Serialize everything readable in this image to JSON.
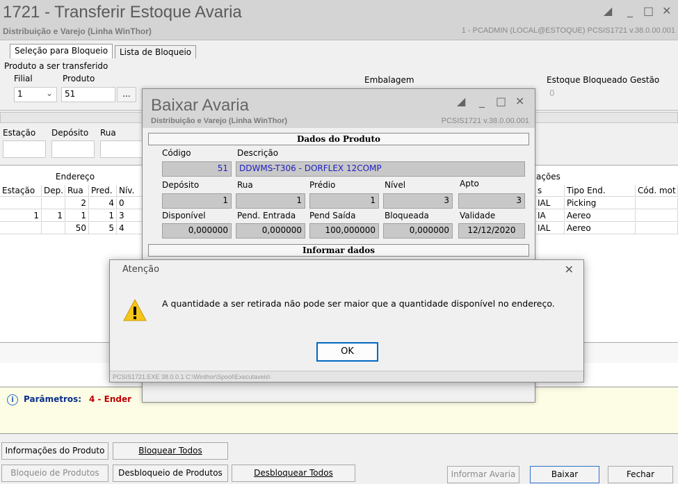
{
  "window": {
    "title": "1721 - Transferir Estoque Avaria",
    "subtitle": "Distribuição e Varejo (Linha WinThor)",
    "session": "1 - PCADMIN (LOCAL@ESTOQUE)   PCSIS1721  v.38.0.00.001"
  },
  "tabs": [
    "Seleção para Bloqueio",
    "Lista de Bloqueio"
  ],
  "form": {
    "group_label": "Produto a ser transferido",
    "filial_label": "Filial",
    "filial_value": "1",
    "produto_label": "Produto",
    "produto_value": "51",
    "produto_btn": "...",
    "embalagem_label": "Embalagem",
    "estoque_label": "Estoque Bloqueado Gestão",
    "estoque_value": "0",
    "estacao_label": "Estação",
    "deposito_label": "Depósito",
    "rua_label": "Rua"
  },
  "grid": {
    "group_header": "Endereço",
    "right_group_header": "ações",
    "columns": [
      "Estação",
      "Dep.",
      "Rua",
      "Pred.",
      "Nív."
    ],
    "right_columns": [
      "s",
      "Tipo End.",
      "Cód. mot"
    ],
    "rows": [
      {
        "estacao": "",
        "dep": "",
        "rua": "2",
        "pred": "4",
        "niv": "0",
        "s": "IAL",
        "tipo": "Picking"
      },
      {
        "estacao": "1",
        "dep": "1",
        "rua": "1",
        "pred": "1",
        "niv": "3",
        "s": "IA",
        "tipo": "Aereo"
      },
      {
        "estacao": "",
        "dep": "",
        "rua": "50",
        "pred": "5",
        "niv": "4",
        "s": "IAL",
        "tipo": "Aereo"
      }
    ]
  },
  "params": {
    "label": "Parâmetros:",
    "value": "4 - Ender"
  },
  "buttons": {
    "info_produto": "Informações do Produto",
    "bloquear_todos": "Bloquear Todos",
    "bloqueio_produtos": "Bloqueio de Produtos",
    "desbloqueio_produtos": "Desbloqueio de Produtos",
    "desbloquear_todos": "Desbloquear Todos",
    "informar_avaria": "Informar Avaria",
    "baixar": "Baixar",
    "fechar": "Fechar"
  },
  "dialog": {
    "title": "Baixar Avaria",
    "subtitle": "Distribuição e Varejo (Linha WinThor)",
    "version": "PCSIS1721  v.38.0.00.001",
    "section_produto": "Dados do Produto",
    "codigo_label": "Código",
    "codigo_value": "51",
    "descricao_label": "Descrição",
    "descricao_value": "DDWMS-T306 - DORFLEX 12COMP",
    "deposito_label": "Depósito",
    "deposito_value": "1",
    "rua_label": "Rua",
    "rua_value": "1",
    "predio_label": "Prédio",
    "predio_value": "1",
    "nivel_label": "Nível",
    "nivel_value": "3",
    "apto_label": "Apto",
    "apto_value": "3",
    "disponivel_label": "Disponível",
    "disponivel_value": "0,000000",
    "pend_entrada_label": "Pend. Entrada",
    "pend_entrada_value": "0,000000",
    "pend_saida_label": "Pend Saída",
    "pend_saida_value": "100,000000",
    "bloqueada_label": "Bloqueada",
    "bloqueada_value": "0,000000",
    "validade_label": "Validade",
    "validade_value": "12/12/2020",
    "section_informar": "Informar dados"
  },
  "alert": {
    "title": "Atenção",
    "message": "A quantidade a ser retirada não pode ser maior que a quantidade disponível no endereço.",
    "ok": "OK",
    "footer": "PCSIS1721.EXE 38.0.0.1 C:\\Winthor\\Spool\\Executaveis\\"
  }
}
